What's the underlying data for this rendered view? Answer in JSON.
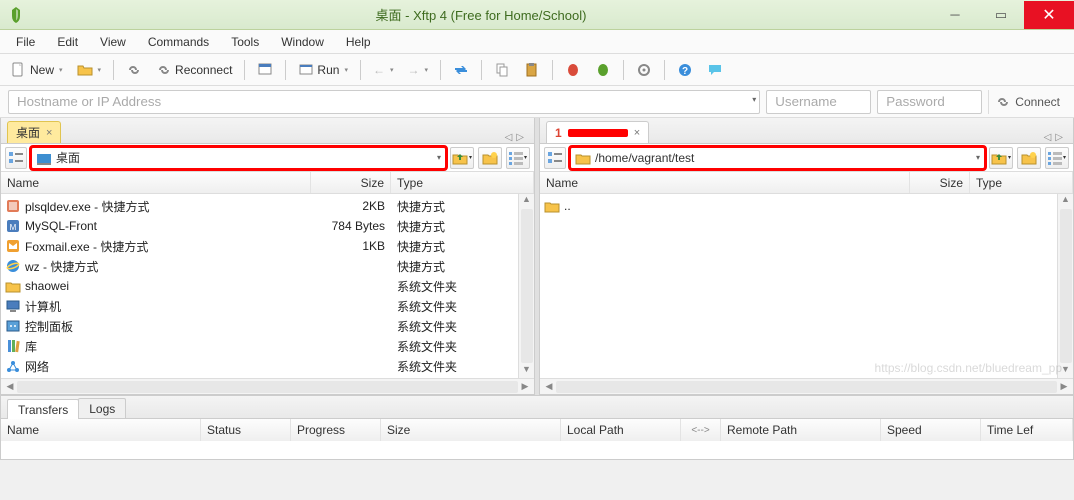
{
  "window": {
    "title": "桌面 - Xftp 4 (Free for Home/School)"
  },
  "menu": [
    "File",
    "Edit",
    "View",
    "Commands",
    "Tools",
    "Window",
    "Help"
  ],
  "toolbar": {
    "new": "New",
    "reconnect": "Reconnect",
    "run": "Run"
  },
  "credbar": {
    "host_placeholder": "Hostname or IP Address",
    "user_placeholder": "Username",
    "pass_placeholder": "Password",
    "connect": "Connect"
  },
  "left_panel": {
    "tab": "桌面",
    "path": "桌面",
    "cols": {
      "name": "Name",
      "size": "Size",
      "type": "Type"
    },
    "rows": [
      {
        "icon": "app",
        "name": "plsqldev.exe - 快捷方式",
        "size": "2KB",
        "type": "快捷方式"
      },
      {
        "icon": "app2",
        "name": "MySQL-Front",
        "size": "784 Bytes",
        "type": "快捷方式"
      },
      {
        "icon": "foxmail",
        "name": "Foxmail.exe - 快捷方式",
        "size": "1KB",
        "type": "快捷方式"
      },
      {
        "icon": "ie",
        "name": "wz - 快捷方式",
        "size": "",
        "type": "快捷方式"
      },
      {
        "icon": "folder",
        "name": "shaowei",
        "size": "",
        "type": "系统文件夹"
      },
      {
        "icon": "computer",
        "name": "计算机",
        "size": "",
        "type": "系统文件夹"
      },
      {
        "icon": "cpanel",
        "name": "控制面板",
        "size": "",
        "type": "系统文件夹"
      },
      {
        "icon": "library",
        "name": "库",
        "size": "",
        "type": "系统文件夹"
      },
      {
        "icon": "network",
        "name": "网络",
        "size": "",
        "type": "系统文件夹"
      }
    ]
  },
  "right_panel": {
    "path": "/home/vagrant/test",
    "cols": {
      "name": "Name",
      "size": "Size",
      "type": "Type"
    },
    "rows": [
      {
        "icon": "folder",
        "name": "..",
        "size": "",
        "type": ""
      }
    ]
  },
  "bottom": {
    "tabs": [
      "Transfers",
      "Logs"
    ],
    "cols": {
      "name": "Name",
      "status": "Status",
      "progress": "Progress",
      "size": "Size",
      "local": "Local Path",
      "arrow": "<-->",
      "remote": "Remote Path",
      "speed": "Speed",
      "timeleft": "Time Lef"
    }
  },
  "watermark": "https://blog.csdn.net/bluedream_pp"
}
